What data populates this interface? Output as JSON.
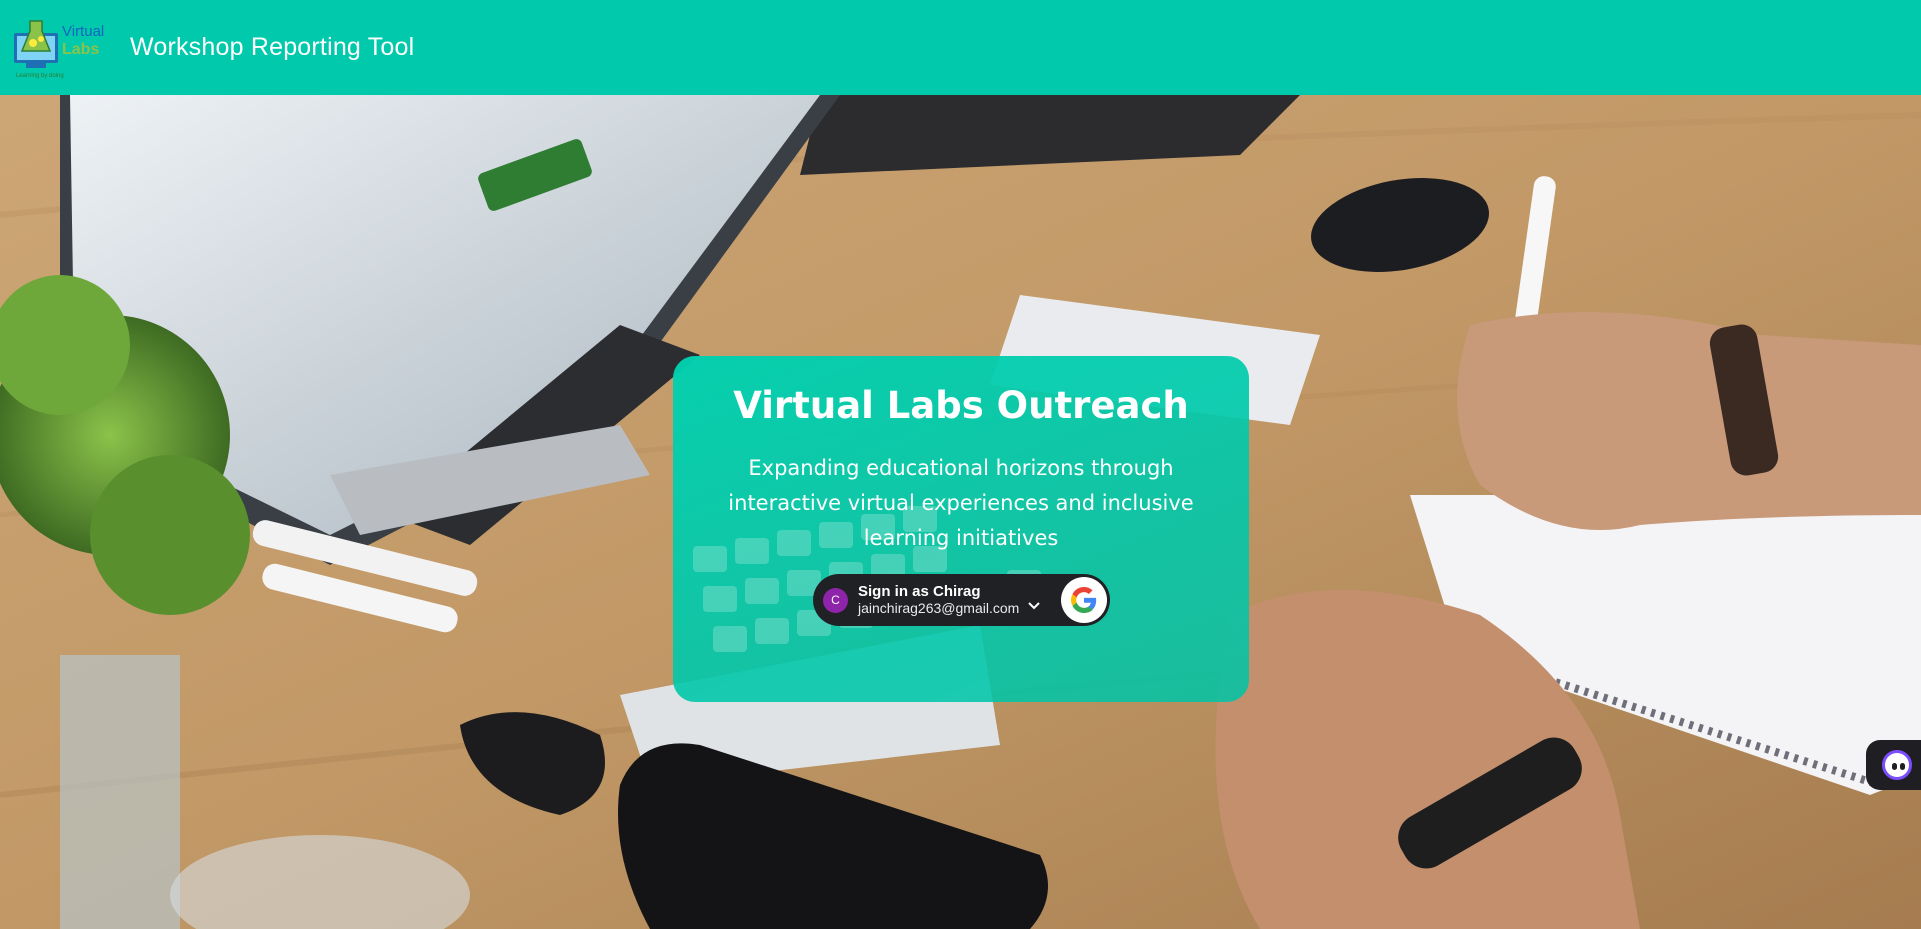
{
  "header": {
    "logo": {
      "top_text": "Virtual",
      "bottom_text": "Labs",
      "tagline": "Learning by doing"
    },
    "title": "Workshop Reporting Tool",
    "background_color": "#00c9ac"
  },
  "hero": {
    "card": {
      "title": "Virtual Labs Outreach",
      "subtitle": "Expanding educational horizons through interactive virtual experiences and inclusive learning initiatives"
    },
    "google_signin": {
      "avatar_initial": "C",
      "label": "Sign in as Chirag",
      "email": "jainchirag263@gmail.com",
      "icon": "google-logo-icon",
      "expand_icon": "chevron-down-icon"
    }
  },
  "chat_widget": {
    "icon": "chatbot-face-icon"
  },
  "colors": {
    "accent": "#00c9ac",
    "card": "#00d1b0",
    "signin_bg": "#202124",
    "avatar": "#8e24aa"
  }
}
